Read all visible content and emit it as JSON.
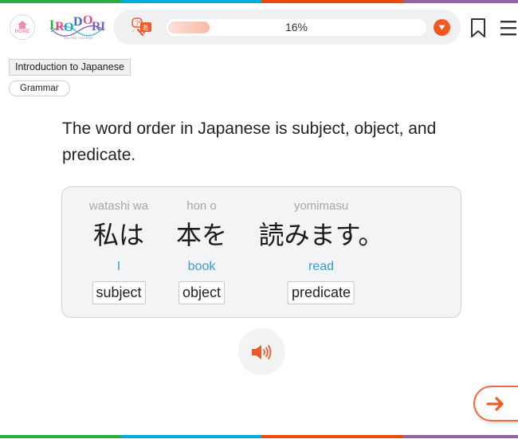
{
  "colors": {
    "bar_green": "#2aab3f",
    "bar_blue": "#00acdc",
    "bar_orange": "#ea4a0c",
    "bar_purple": "#9262a3",
    "accent": "#ef5a24",
    "meaning_blue": "#3a9bd6"
  },
  "header": {
    "home_label": "HOME",
    "logo_text": "IRODORI",
    "logo_subtitle": "ONLINE COURSE",
    "progress_percent": 16,
    "progress_label": "16%",
    "icons": {
      "dictionary": "dictionary-search-icon",
      "dropdown": "chevron-down-icon",
      "bookmark": "bookmark-icon",
      "menu": "hamburger-menu-icon"
    }
  },
  "breadcrumb": {
    "course": "Introduction to Japanese",
    "category": "Grammar"
  },
  "lesson": {
    "text": "The word order in Japanese is subject, object, and predicate."
  },
  "sentence": {
    "words": [
      {
        "romaji": "watashi wa",
        "japanese": "私は",
        "meaning": "I",
        "role": "subject"
      },
      {
        "romaji": "hon o",
        "japanese": "本を",
        "meaning": "book",
        "role": "object"
      },
      {
        "romaji": "yomimasu",
        "japanese": "読みます。",
        "meaning": "read",
        "role": "predicate"
      }
    ]
  },
  "controls": {
    "audio_icon": "speaker-icon",
    "next_icon": "arrow-right-icon"
  }
}
